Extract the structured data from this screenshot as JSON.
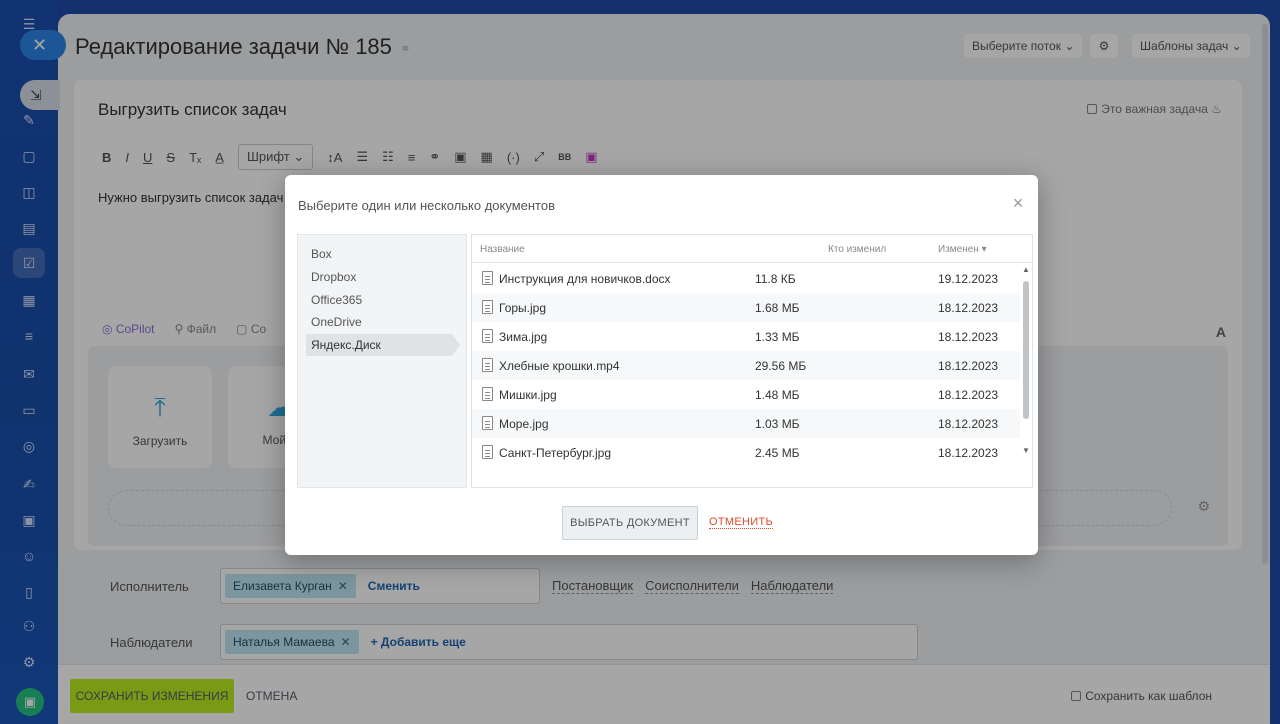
{
  "sidebar": {
    "close_icon": "close-icon",
    "import_icon": "import-icon",
    "icons": [
      "tasks-icon",
      "chat-icon",
      "calendar-icon",
      "docs-icon",
      "tasks-active-icon",
      "planner-icon",
      "filter-icon",
      "mail-icon",
      "card-icon",
      "target-icon",
      "sign-icon",
      "contacts-icon",
      "users-icon",
      "doc-icon",
      "automation-icon",
      "settings-icon"
    ],
    "bottom_icon": "market-icon"
  },
  "header": {
    "title": "Редактирование задачи № 185",
    "flow_button": "Выберите поток",
    "templates_button": "Шаблоны задач"
  },
  "task": {
    "name": "Выгрузить список задач",
    "important_label": "Это важная задача",
    "font_select": "Шрифт",
    "body_text": "Нужно выгрузить список задач",
    "tabs": {
      "copilot": "CoPilot",
      "file": "Файл",
      "third": "Со"
    },
    "font_a": "A",
    "upload_tiles": {
      "upload": "Загрузить",
      "my_drive": "Мой Д"
    }
  },
  "people": {
    "executor_label": "Исполнитель",
    "executor_name": "Елизавета Курган",
    "change_link": "Сменить",
    "roles": [
      "Постановщик",
      "Соисполнители",
      "Наблюдатели"
    ],
    "observers_label": "Наблюдатели",
    "observer_name": "Наталья Мамаева",
    "add_more": "+ Добавить еще"
  },
  "footer": {
    "save": "СОХРАНИТЬ ИЗМЕНЕНИЯ",
    "cancel": "ОТМЕНА",
    "save_template": "Сохранить как шаблон"
  },
  "dialog": {
    "title": "Выберите один или несколько документов",
    "services": [
      "Box",
      "Dropbox",
      "Office365",
      "OneDrive",
      "Яндекс.Диск"
    ],
    "active_service": "Яндекс.Диск",
    "columns": {
      "name": "Название",
      "modified_by": "Кто изменил",
      "modified": "Изменен ▾"
    },
    "files": [
      {
        "name": "Инструкция для новичков.docx",
        "size": "11.8 КБ",
        "date": "19.12.2023"
      },
      {
        "name": "Горы.jpg",
        "size": "1.68 МБ",
        "date": "18.12.2023"
      },
      {
        "name": "Зима.jpg",
        "size": "1.33 МБ",
        "date": "18.12.2023"
      },
      {
        "name": "Хлебные крошки.mp4",
        "size": "29.56 МБ",
        "date": "18.12.2023"
      },
      {
        "name": "Мишки.jpg",
        "size": "1.48 МБ",
        "date": "18.12.2023"
      },
      {
        "name": "Море.jpg",
        "size": "1.03 МБ",
        "date": "18.12.2023"
      },
      {
        "name": "Санкт-Петербург.jpg",
        "size": "2.45 МБ",
        "date": "18.12.2023"
      }
    ],
    "select_button": "ВЫБРАТЬ ДОКУМЕНТ",
    "cancel_link": "ОТМЕНИТЬ"
  }
}
